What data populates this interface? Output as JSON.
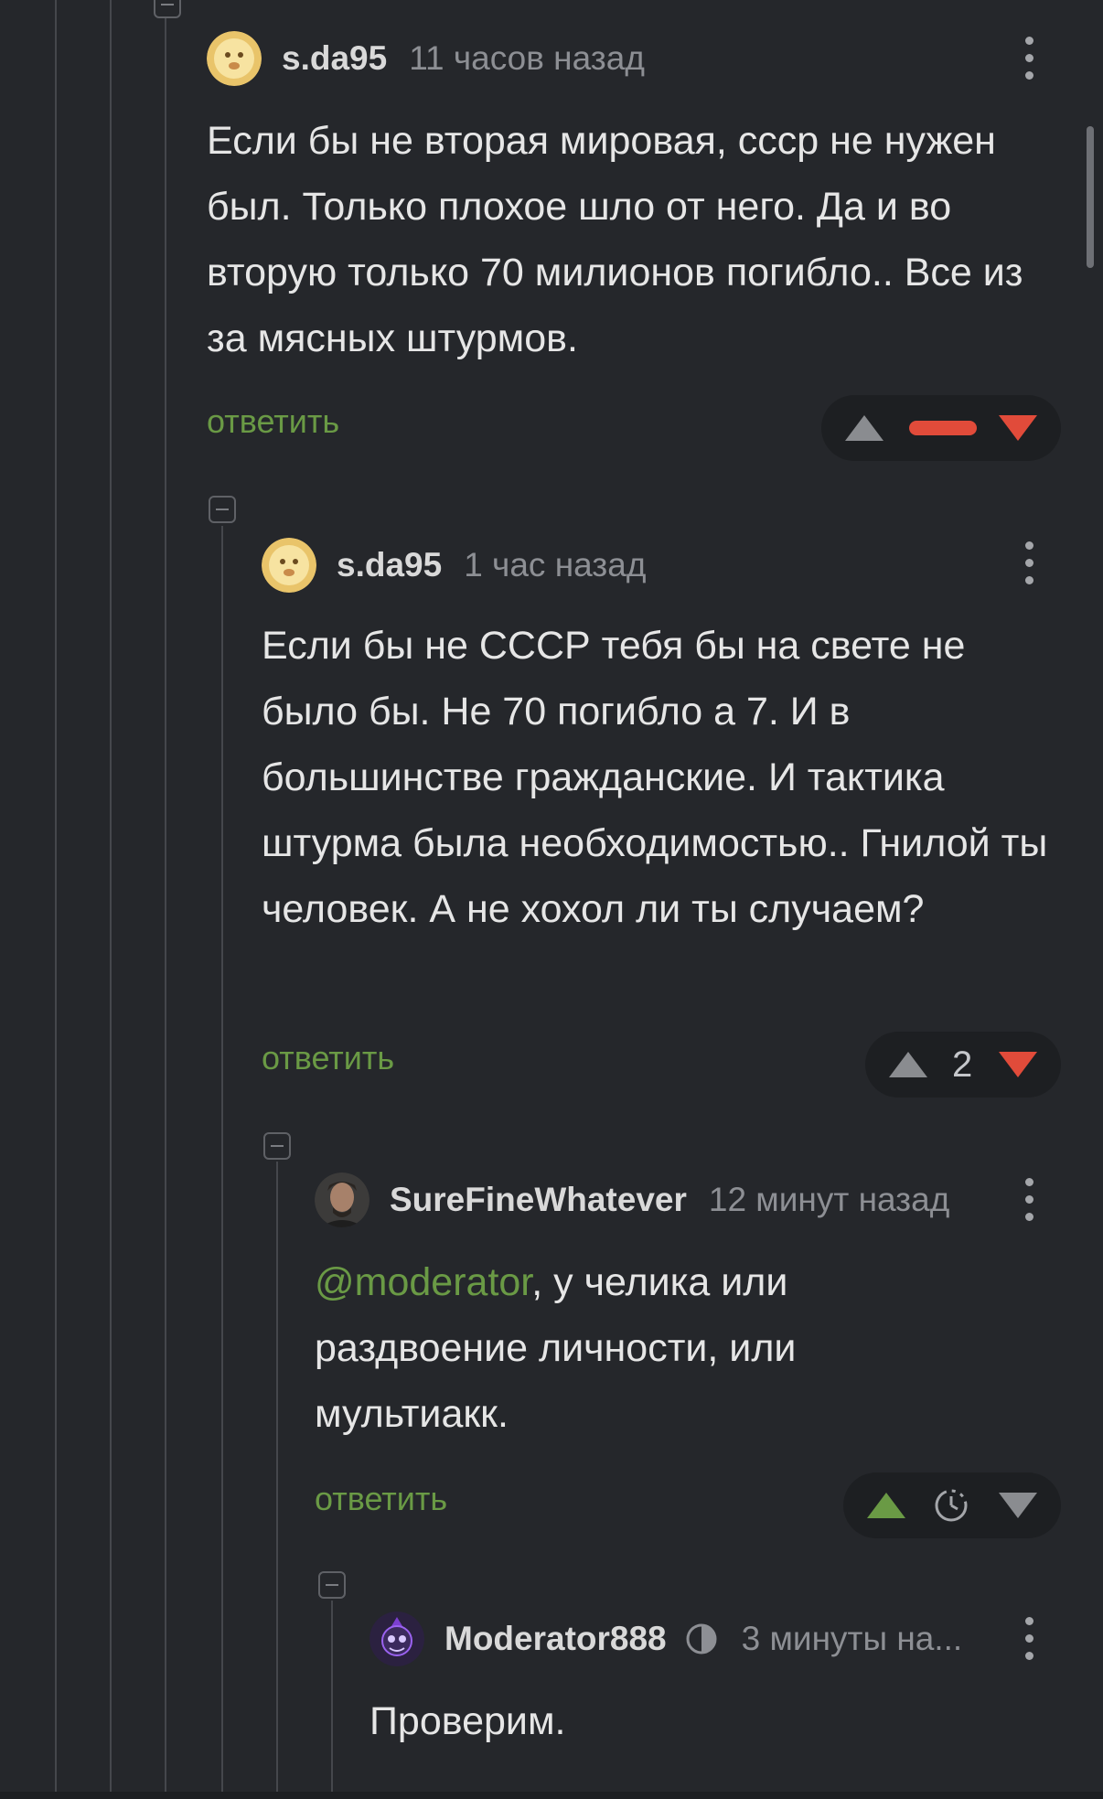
{
  "comments": [
    {
      "username": "s.da95",
      "timestamp": "11 часов назад",
      "text": "Если бы не вторая мировая, ссср не нужен был. Только плохое шло от него. Да и во вторую только 70 милионов погибло.. Все из за мясных штурмов.",
      "reply_label": "ответить",
      "rating": "",
      "avatar_icon": "emoji-face-avatar"
    },
    {
      "username": "s.da95",
      "timestamp": "1 час назад",
      "text": "Если бы не СССР тебя бы на свете не было бы. Не 70 погибло а 7. И в большинстве гражданские. И тактика штурма была необходимостью.. Гнилой ты человек. А не хохол ли ты случаем?",
      "reply_label": "ответить",
      "rating": "2",
      "avatar_icon": "emoji-face-avatar"
    },
    {
      "username": "SureFineWhatever",
      "timestamp": "12 минут назад",
      "mention": "@moderator",
      "text_after_mention": ", у челика или раздвоение личности, или мультиакк.",
      "reply_label": "ответить",
      "rating": "",
      "avatar_icon": "photo-avatar"
    },
    {
      "username": "Moderator888",
      "timestamp": "3 минуты на...",
      "text": "Проверим.",
      "avatar_icon": "moderator-avatar",
      "badge_icon": "moderator-badge-icon"
    }
  ],
  "colors": {
    "background": "#25272b",
    "accent_green": "#6a9a45",
    "downvote_red": "#e14b3a",
    "pill_bg": "#1d1f22"
  }
}
